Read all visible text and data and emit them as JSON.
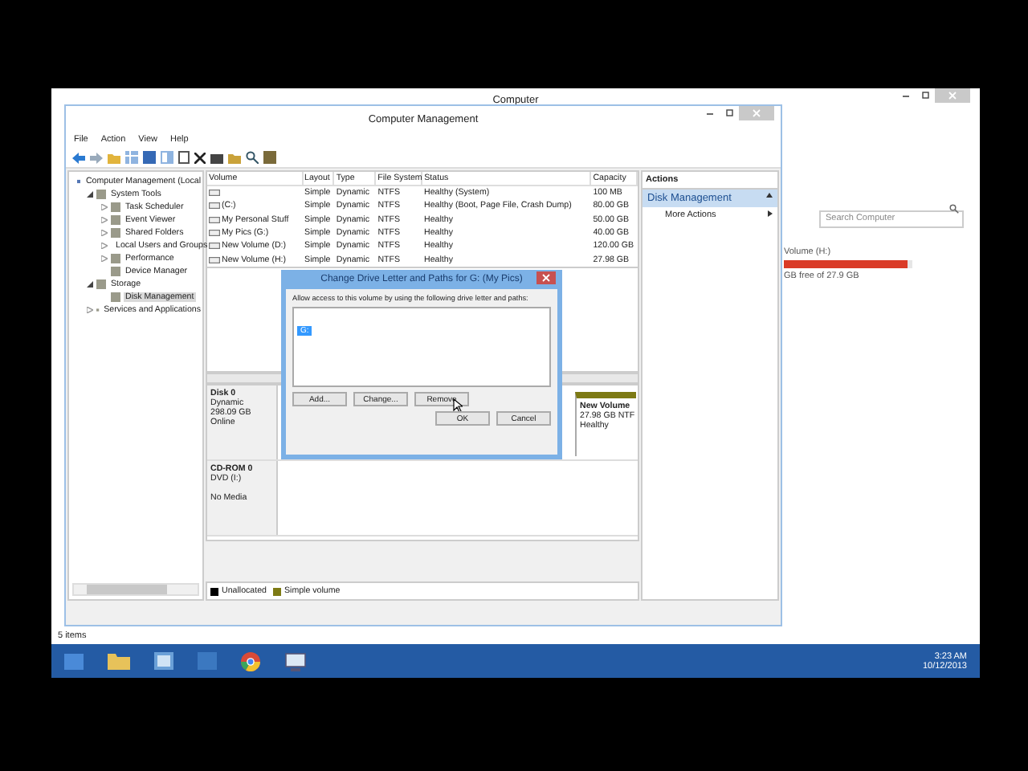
{
  "background_window": {
    "title": "Computer",
    "search": {
      "placeholder": "Search Computer"
    },
    "drive": {
      "name": "Volume (H:)",
      "level": 0.96,
      "free_text": "GB free of 27.9 GB"
    },
    "status_bar": "5 items"
  },
  "window": {
    "title": "Computer Management",
    "menu": [
      "File",
      "Action",
      "View",
      "Help"
    ],
    "tree": [
      {
        "label": "Computer Management (Local",
        "selected": false,
        "children": [
          {
            "label": "System Tools",
            "selected": false,
            "expanded": true,
            "children": [
              {
                "label": "Task Scheduler",
                "selected": false,
                "expanded": false
              },
              {
                "label": "Event Viewer",
                "selected": false,
                "expanded": false
              },
              {
                "label": "Shared Folders",
                "selected": false,
                "expanded": false
              },
              {
                "label": "Local Users and Groups",
                "selected": false,
                "expanded": false
              },
              {
                "label": "Performance",
                "selected": false,
                "expanded": false
              },
              {
                "label": "Device Manager",
                "selected": false
              }
            ]
          },
          {
            "label": "Storage",
            "selected": false,
            "expanded": true,
            "children": [
              {
                "label": "Disk Management",
                "selected": true
              }
            ]
          },
          {
            "label": "Services and Applications",
            "selected": false,
            "expanded": false
          }
        ]
      }
    ],
    "table": {
      "columns": [
        "Volume",
        "Layout",
        "Type",
        "File System",
        "Status",
        "Capacity"
      ],
      "rows": [
        {
          "layout": "Simple",
          "type": "Dynamic",
          "file_system": "NTFS",
          "status": "Healthy (System)",
          "capacity": "100 MB"
        },
        {
          "volume": "(C:)",
          "layout": "Simple",
          "type": "Dynamic",
          "file_system": "NTFS",
          "status": "Healthy (Boot, Page File, Crash Dump)",
          "capacity": "80.00 GB"
        },
        {
          "volume": "My Personal Stuff",
          "layout": "Simple",
          "type": "Dynamic",
          "file_system": "NTFS",
          "status": "Healthy",
          "capacity": "50.00 GB"
        },
        {
          "volume": "My Pics (G:)",
          "layout": "Simple",
          "type": "Dynamic",
          "file_system": "NTFS",
          "status": "Healthy",
          "capacity": "40.00 GB"
        },
        {
          "volume": "New Volume (D:)",
          "layout": "Simple",
          "type": "Dynamic",
          "file_system": "NTFS",
          "status": "Healthy",
          "capacity": "120.00 GB"
        },
        {
          "volume": "New Volume (H:)",
          "layout": "Simple",
          "type": "Dynamic",
          "file_system": "NTFS",
          "status": "Healthy",
          "capacity": "27.98 GB"
        }
      ]
    },
    "disks": [
      {
        "name": "Disk 0",
        "lines": [
          "Dynamic",
          "298.09 GB",
          "Online"
        ],
        "partition": {
          "name": "New Volume",
          "size": "27.98 GB NTF",
          "status": "Healthy"
        }
      },
      {
        "name": "CD-ROM 0",
        "lines": [
          "DVD (I:)",
          "No Media"
        ]
      }
    ],
    "legend": [
      {
        "label": "Unallocated",
        "color": "#000000"
      },
      {
        "label": "Simple volume",
        "color": "#7d7a14"
      }
    ],
    "actions": {
      "header": "Actions",
      "section": "Disk Management",
      "items": [
        "More Actions"
      ]
    }
  },
  "dialog": {
    "title": "Change Drive Letter and Paths for G: (My Pics)",
    "instruction": "Allow access to this volume by using the following drive letter and paths:",
    "paths": [
      {
        "label": "G:",
        "selected": true
      }
    ],
    "buttons": [
      "Add...",
      "Change...",
      "Remove"
    ],
    "footer_buttons": [
      "OK",
      "Cancel"
    ]
  },
  "taskbar": {
    "time": "3:23 AM",
    "date": "10/12/2013"
  }
}
